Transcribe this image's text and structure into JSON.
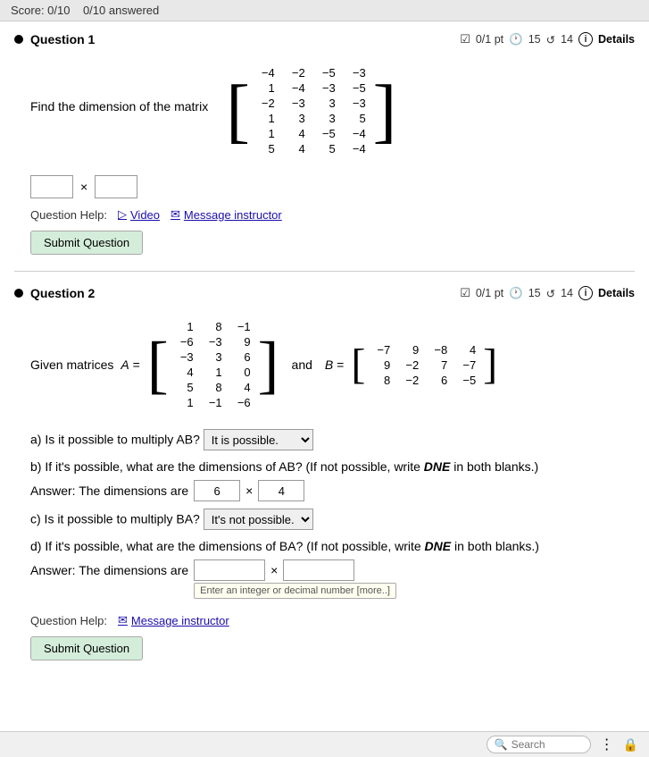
{
  "topbar": {
    "score": "Score: 0/10",
    "answered": "0/10 answered"
  },
  "question1": {
    "title": "Question 1",
    "meta": {
      "pts": "0/1 pt",
      "clock": "15",
      "refresh": "14",
      "details": "Details"
    },
    "body_text": "Find the dimension of the matrix",
    "matrix": {
      "rows": [
        [
          "-4",
          "-2",
          "-5",
          "-3"
        ],
        [
          "1",
          "-4",
          "-3",
          "-5"
        ],
        [
          "-2",
          "-3",
          "3",
          "-3"
        ],
        [
          "1",
          "3",
          "3",
          "5"
        ],
        [
          "1",
          "4",
          "-5",
          "-4"
        ],
        [
          "5",
          "4",
          "5",
          "-4"
        ]
      ]
    },
    "dimension_input": {
      "value1": "",
      "value2": "",
      "separator": "×"
    },
    "help": {
      "label": "Question Help:",
      "video": "Video",
      "message": "Message instructor"
    },
    "submit_label": "Submit Question"
  },
  "question2": {
    "title": "Question 2",
    "meta": {
      "pts": "0/1 pt",
      "clock": "15",
      "refresh": "14",
      "details": "Details"
    },
    "matrix_A": {
      "rows": [
        [
          "1",
          "8",
          "-1"
        ],
        [
          "-6",
          "-3",
          "9"
        ],
        [
          "-3",
          "3",
          "6"
        ],
        [
          "4",
          "1",
          "0"
        ],
        [
          "5",
          "8",
          "4"
        ],
        [
          "1",
          "-1",
          "-6"
        ]
      ],
      "label": "A ="
    },
    "matrix_B": {
      "rows": [
        [
          "-7",
          "9",
          "-8",
          "4"
        ],
        [
          "9",
          "-2",
          "7",
          "-7"
        ],
        [
          "8",
          "-2",
          "6",
          "-5"
        ]
      ],
      "label": "B ="
    },
    "and_text": "and",
    "given_text": "Given matrices",
    "sub_a": {
      "question": "a) Is it possible to multiply AB?",
      "dropdown_value": "It is possible.",
      "options": [
        "It is possible.",
        "It's not possible."
      ]
    },
    "sub_b": {
      "question": "b) If it's possible, what are the dimensions of AB? (If not possible, write",
      "dne": "DNE",
      "question2": "in both blanks.)",
      "label": "Answer: The dimensions are",
      "val1": "6",
      "val2": "4",
      "separator": "×"
    },
    "sub_c": {
      "question": "c) Is it possible to multiply BA?",
      "dropdown_value": "It's not possible.",
      "options": [
        "It is possible.",
        "It's not possible."
      ]
    },
    "sub_d": {
      "question": "d) If it's possible, what are the dimensions of BA? (If not possible, write",
      "dne": "DNE",
      "question2": "in both blanks.)",
      "label": "Answer: The dimensions are",
      "val1": "",
      "val2": "",
      "tooltip": "Enter an integer or decimal number [more..]",
      "separator": "×"
    },
    "help": {
      "label": "Question Help:",
      "message": "Message instructor"
    },
    "submit_label": "Submit Question"
  },
  "bottombar": {
    "search_placeholder": "Search",
    "icons": [
      "dots-icon",
      "lock-icon"
    ]
  }
}
